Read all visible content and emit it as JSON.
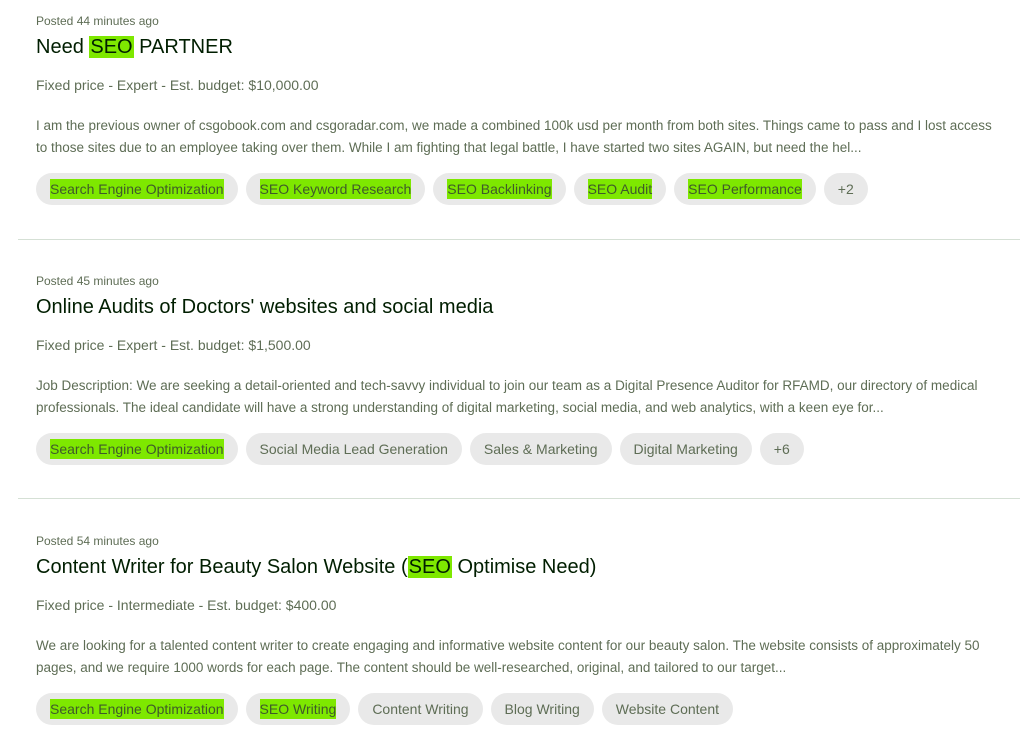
{
  "jobs": [
    {
      "posted": "Posted 44 minutes ago",
      "title_parts": [
        "Need ",
        "SEO",
        " PARTNER"
      ],
      "meta": "Fixed price - Expert - Est. budget: $10,000.00",
      "description": "I am the previous owner of csgobook.com and csgoradar.com, we made a combined 100k usd per month from both sites. Things came to pass and I lost access to those sites due to an employee taking over them. While I am fighting that legal battle, I have started two sites AGAIN, but need the hel...",
      "tags": [
        "Search Engine Optimization",
        "SEO Keyword Research",
        "SEO Backlinking",
        "SEO Audit",
        "SEO Performance",
        "+2"
      ]
    },
    {
      "posted": "Posted 45 minutes ago",
      "title_parts": [
        "Online Audits of Doctors' websites and social media",
        "",
        ""
      ],
      "meta": "Fixed price - Expert - Est. budget: $1,500.00",
      "description": "Job Description: We are seeking a detail-oriented and tech-savvy individual to join our team as a Digital Presence Auditor for RFAMD, our directory of medical professionals. The ideal candidate will have a strong understanding of digital marketing, social media, and web analytics, with a keen eye for...",
      "tags": [
        "Search Engine Optimization",
        "Social Media Lead Generation",
        "Sales & Marketing",
        "Digital Marketing",
        "+6"
      ]
    },
    {
      "posted": "Posted 54 minutes ago",
      "title_parts": [
        "Content Writer for Beauty Salon Website (",
        "SEO",
        " Optimise Need)"
      ],
      "meta": "Fixed price - Intermediate - Est. budget: $400.00",
      "description": "We are looking for a talented content writer to create engaging and informative website content for our beauty salon. The website consists of approximately 50 pages, and we require 1000 words for each page. The content should be well-researched, original, and tailored to our target...",
      "tags": [
        "Search Engine Optimization",
        "SEO Writing",
        "Content Writing",
        "Blog Writing",
        "Website Content"
      ]
    }
  ],
  "colors": {
    "highlight": "#7ee800",
    "tag_bg": "#e9e9e9",
    "text": "#001e00",
    "muted": "#5e6d55"
  }
}
